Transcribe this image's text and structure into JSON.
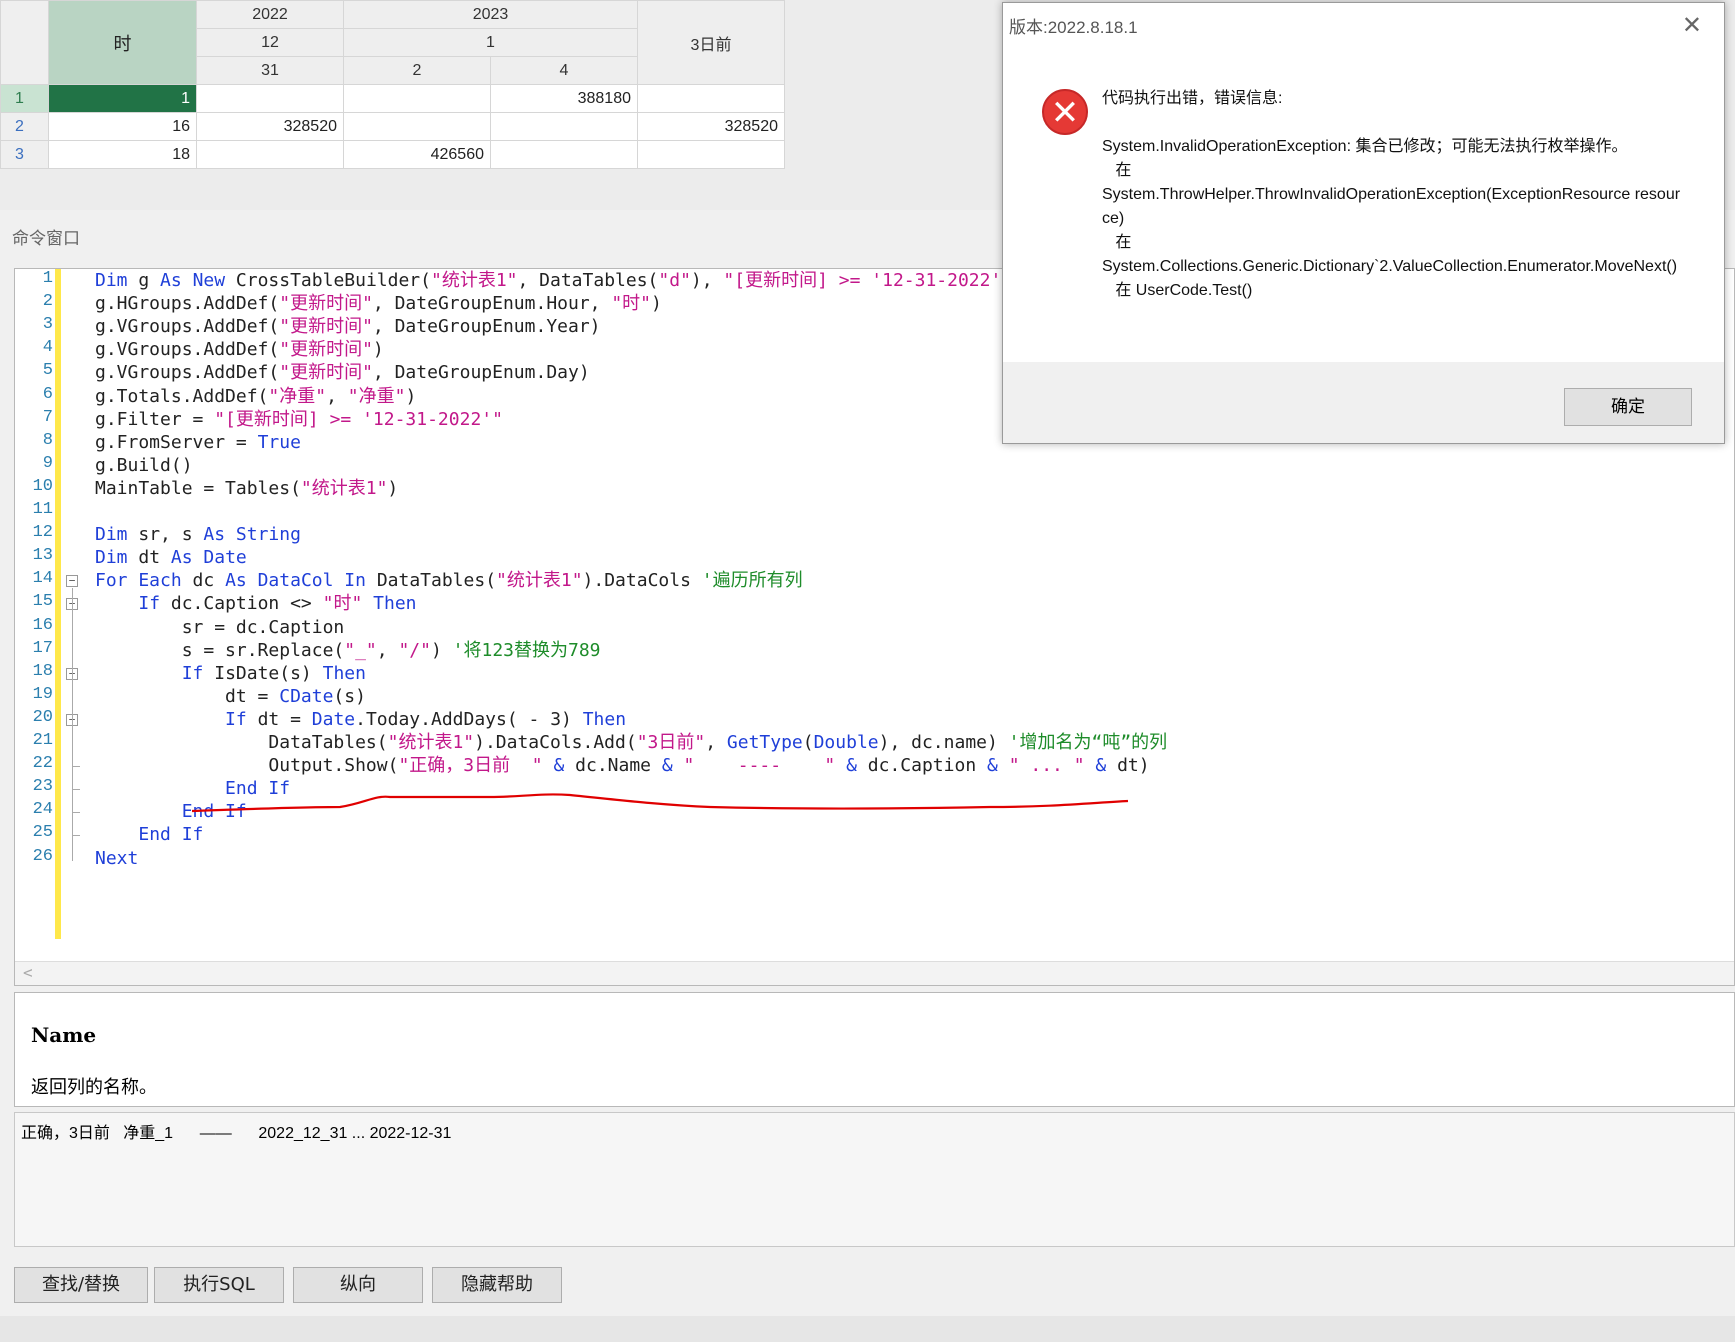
{
  "grid": {
    "header_rows": [
      [
        "时",
        "2022",
        "2023",
        "",
        "3日前"
      ],
      [
        "",
        "12",
        "1",
        "",
        ""
      ],
      [
        "",
        "31",
        "2",
        "4",
        ""
      ]
    ],
    "time_header": "时",
    "years": [
      "2022",
      "2023"
    ],
    "months": [
      "12",
      "1"
    ],
    "days": [
      "31",
      "2",
      "4"
    ],
    "three_days_header": "3日前",
    "rows": [
      {
        "no": "1",
        "hour": "1",
        "c1": "",
        "c2": "",
        "c3": "388180",
        "c4": ""
      },
      {
        "no": "2",
        "hour": "16",
        "c1": "328520",
        "c2": "",
        "c3": "",
        "c4": "328520"
      },
      {
        "no": "3",
        "hour": "18",
        "c1": "",
        "c2": "426560",
        "c3": "",
        "c4": ""
      }
    ]
  },
  "command_window": {
    "title": "命令窗口",
    "line_numbers": [
      "1",
      "2",
      "3",
      "4",
      "5",
      "6",
      "7",
      "8",
      "9",
      "10",
      "11",
      "12",
      "13",
      "14",
      "15",
      "16",
      "17",
      "18",
      "19",
      "20",
      "21",
      "22",
      "23",
      "24",
      "25",
      "26"
    ],
    "scroll_glyph": "<"
  },
  "code": {
    "l1": [
      [
        "kw",
        "Dim"
      ],
      [
        "t",
        " g "
      ],
      [
        "kw",
        "As"
      ],
      [
        "t",
        " "
      ],
      [
        "kw",
        "New"
      ],
      [
        "t",
        " CrossTableBuilder("
      ],
      [
        "st",
        "\"统计表1\""
      ],
      [
        "t",
        ", DataTables("
      ],
      [
        "st",
        "\"d\""
      ],
      [
        "t",
        "), "
      ],
      [
        "st",
        "\"[更新时间] >= '12-31-2022'\""
      ],
      [
        "t",
        ")"
      ]
    ],
    "l2": [
      [
        "t",
        "g.HGroups.AddDef("
      ],
      [
        "st",
        "\"更新时间\""
      ],
      [
        "t",
        ", DateGroupEnum.Hour, "
      ],
      [
        "st",
        "\"时\""
      ],
      [
        "t",
        ")"
      ]
    ],
    "l3": [
      [
        "t",
        "g.VGroups.AddDef("
      ],
      [
        "st",
        "\"更新时间\""
      ],
      [
        "t",
        ", DateGroupEnum.Year)"
      ]
    ],
    "l4": [
      [
        "t",
        "g.VGroups.AddDef("
      ],
      [
        "st",
        "\"更新时间\""
      ],
      [
        "t",
        ")"
      ]
    ],
    "l5": [
      [
        "t",
        "g.VGroups.AddDef("
      ],
      [
        "st",
        "\"更新时间\""
      ],
      [
        "t",
        ", DateGroupEnum.Day)"
      ]
    ],
    "l6": [
      [
        "t",
        "g.Totals.AddDef("
      ],
      [
        "st",
        "\"净重\""
      ],
      [
        "t",
        ", "
      ],
      [
        "st",
        "\"净重\""
      ],
      [
        "t",
        ")"
      ]
    ],
    "l7": [
      [
        "t",
        "g.Filter = "
      ],
      [
        "st",
        "\"[更新时间] >= '12-31-2022'\""
      ]
    ],
    "l8": [
      [
        "t",
        "g.FromServer = "
      ],
      [
        "kw",
        "True"
      ]
    ],
    "l9": [
      [
        "t",
        "g.Build()"
      ]
    ],
    "l10": [
      [
        "t",
        "MainTable = Tables("
      ],
      [
        "st",
        "\"统计表1\""
      ],
      [
        "t",
        ")"
      ]
    ],
    "l11": [],
    "l12": [
      [
        "kw",
        "Dim"
      ],
      [
        "t",
        " sr, s "
      ],
      [
        "kw",
        "As"
      ],
      [
        "t",
        " "
      ],
      [
        "kw",
        "String"
      ]
    ],
    "l13": [
      [
        "kw",
        "Dim"
      ],
      [
        "t",
        " dt "
      ],
      [
        "kw",
        "As"
      ],
      [
        "t",
        " "
      ],
      [
        "kw",
        "Date"
      ]
    ],
    "l14": [
      [
        "kw",
        "For Each"
      ],
      [
        "t",
        " dc "
      ],
      [
        "kw",
        "As"
      ],
      [
        "t",
        " "
      ],
      [
        "kw",
        "DataCol"
      ],
      [
        "t",
        " "
      ],
      [
        "kw",
        "In"
      ],
      [
        "t",
        " DataTables("
      ],
      [
        "st",
        "\"统计表1\""
      ],
      [
        "t",
        ").DataCols "
      ],
      [
        "cm",
        "'遍历所有列"
      ]
    ],
    "l15": [
      [
        "t",
        "    "
      ],
      [
        "kw",
        "If"
      ],
      [
        "t",
        " dc.Caption <> "
      ],
      [
        "st",
        "\"时\""
      ],
      [
        "t",
        " "
      ],
      [
        "kw",
        "Then"
      ]
    ],
    "l16": [
      [
        "t",
        "        sr = dc.Caption"
      ]
    ],
    "l17": [
      [
        "t",
        "        s = sr.Replace("
      ],
      [
        "st",
        "\"_\""
      ],
      [
        "t",
        ", "
      ],
      [
        "st",
        "\"/\""
      ],
      [
        "t",
        ") "
      ],
      [
        "cm",
        "'将123替换为789"
      ]
    ],
    "l18": [
      [
        "t",
        "        "
      ],
      [
        "kw",
        "If"
      ],
      [
        "t",
        " IsDate(s) "
      ],
      [
        "kw",
        "Then"
      ]
    ],
    "l19": [
      [
        "t",
        "            dt = "
      ],
      [
        "kw",
        "CDate"
      ],
      [
        "t",
        "(s)"
      ]
    ],
    "l20": [
      [
        "t",
        "            "
      ],
      [
        "kw",
        "If"
      ],
      [
        "t",
        " dt = "
      ],
      [
        "kw",
        "Date"
      ],
      [
        "t",
        ".Today.AddDays( - 3) "
      ],
      [
        "kw",
        "Then"
      ]
    ],
    "l21": [
      [
        "t",
        "                DataTables("
      ],
      [
        "st",
        "\"统计表1\""
      ],
      [
        "t",
        ").DataCols.Add("
      ],
      [
        "st",
        "\"3日前\""
      ],
      [
        "t",
        ", "
      ],
      [
        "kw",
        "GetType"
      ],
      [
        "t",
        "("
      ],
      [
        "kw",
        "Double"
      ],
      [
        "t",
        "), dc.name) "
      ],
      [
        "cm",
        "'增加名为“吨”的列"
      ]
    ],
    "l22": [
      [
        "t",
        "                Output.Show("
      ],
      [
        "st",
        "\"正确，3日前  \""
      ],
      [
        "t",
        " "
      ],
      [
        "kw",
        "&"
      ],
      [
        "t",
        " dc.Name "
      ],
      [
        "kw",
        "&"
      ],
      [
        "t",
        " "
      ],
      [
        "st",
        "\"    ----    \""
      ],
      [
        "t",
        " "
      ],
      [
        "kw",
        "&"
      ],
      [
        "t",
        " dc.Caption "
      ],
      [
        "kw",
        "&"
      ],
      [
        "t",
        " "
      ],
      [
        "st",
        "\" ... \""
      ],
      [
        "t",
        " "
      ],
      [
        "kw",
        "&"
      ],
      [
        "t",
        " dt)"
      ]
    ],
    "l23": [
      [
        "t",
        "            "
      ],
      [
        "kw",
        "End If"
      ]
    ],
    "l24": [
      [
        "t",
        "        "
      ],
      [
        "kw",
        "End If"
      ]
    ],
    "l25": [
      [
        "t",
        "    "
      ],
      [
        "kw",
        "End If"
      ]
    ],
    "l26": [
      [
        "kw",
        "Next"
      ]
    ]
  },
  "help": {
    "name": "Name",
    "description": "返回列的名称。"
  },
  "output": {
    "line": "正确，3日前   净重_1      ——      2022_12_31 ... 2022-12-31"
  },
  "buttons": {
    "find_replace": "查找/替换",
    "exec_sql": "执行SQL",
    "vertical": "纵向",
    "hide_help": "隐藏帮助"
  },
  "dialog": {
    "title": "版本:2022.8.18.1",
    "close_glyph": "✕",
    "icon_glyph": "✕",
    "message": "代码执行出错，错误信息:\n\nSystem.InvalidOperationException: 集合已修改；可能无法执行枚举操作。\n   在\nSystem.ThrowHelper.ThrowInvalidOperationException(ExceptionResource resource)\n   在\nSystem.Collections.Generic.Dictionary`2.ValueCollection.Enumerator.MoveNext()\n   在 UserCode.Test()",
    "ok_label": "确定"
  },
  "colors": {
    "keyword": "#1f3fd8",
    "string": "#c2188a",
    "comment": "#1e8c2a",
    "active_cell": "#217346",
    "error_icon": "#e53935",
    "annotation_underline": "#e00000"
  }
}
